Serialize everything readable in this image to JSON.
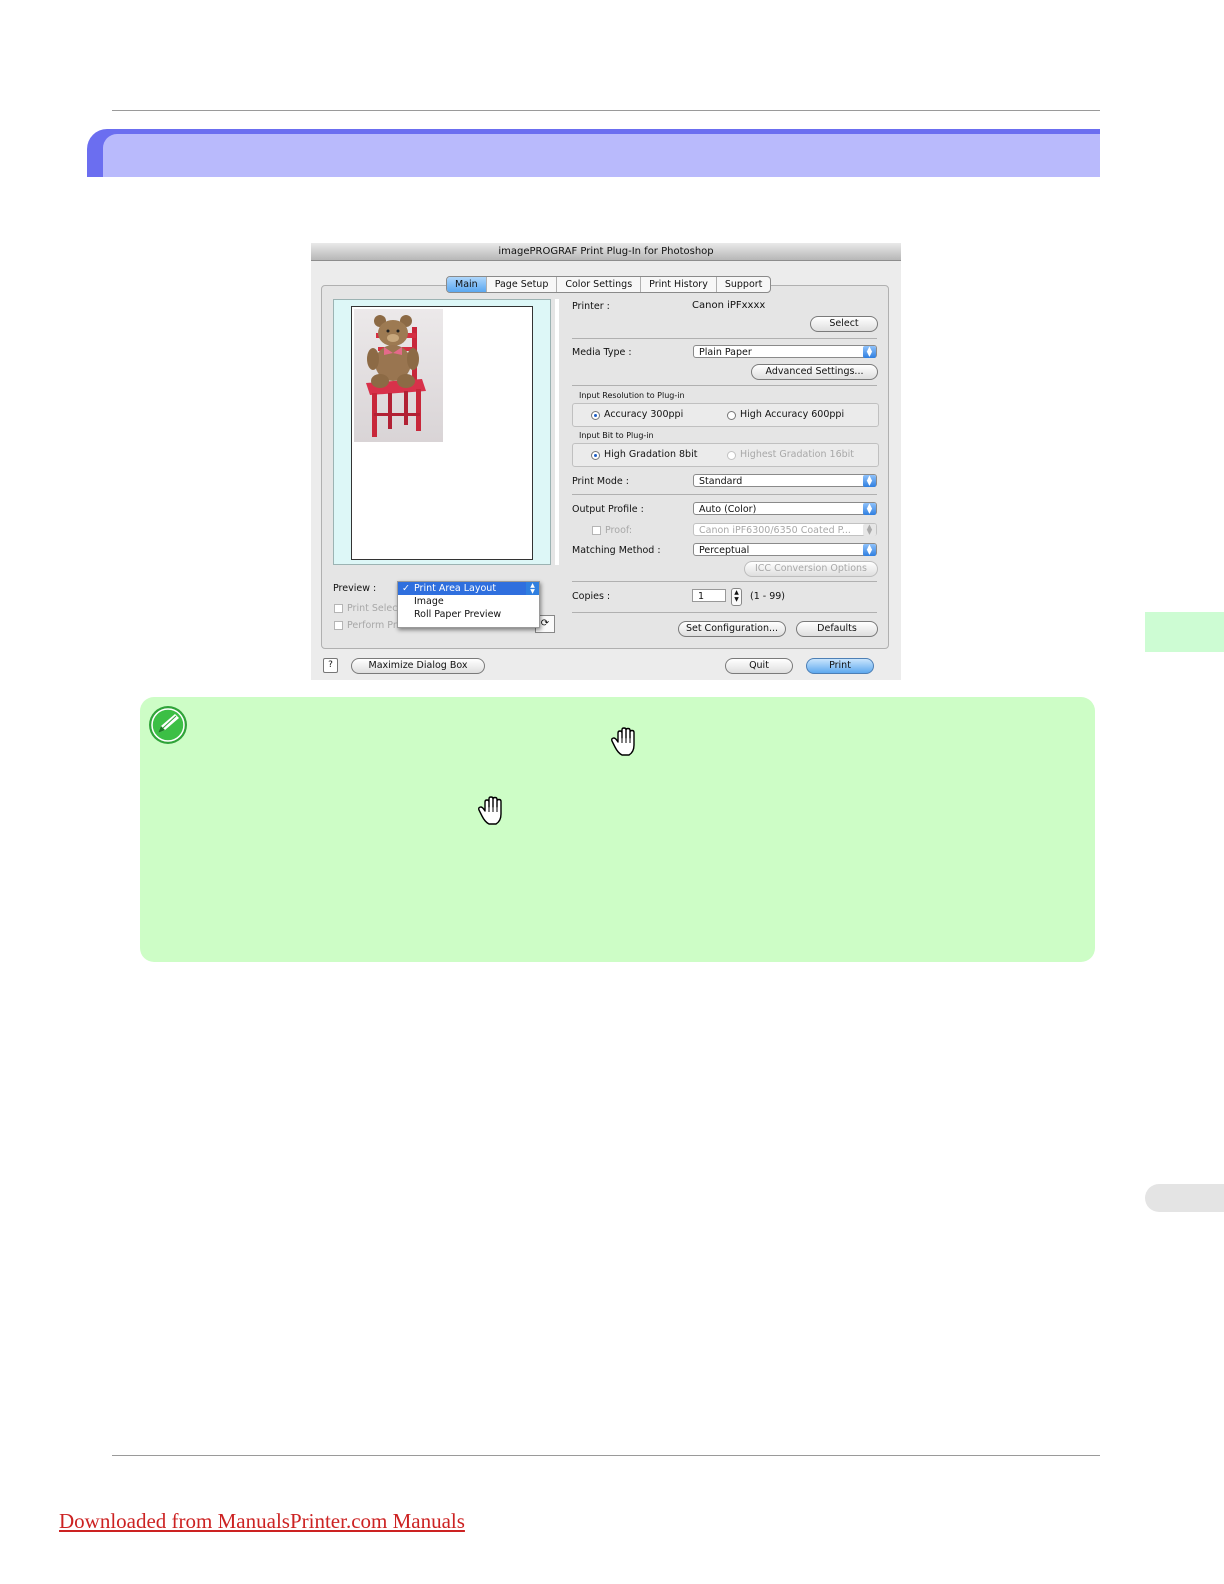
{
  "dialog": {
    "title": "imagePROGRAF Print Plug-In for Photoshop",
    "tabs": [
      {
        "label": "Main",
        "active": true
      },
      {
        "label": "Page Setup",
        "active": false
      },
      {
        "label": "Color Settings",
        "active": false
      },
      {
        "label": "Print History",
        "active": false
      },
      {
        "label": "Support",
        "active": false
      }
    ],
    "printer_label": "Printer :",
    "printer_value": "Canon iPFxxxx",
    "select_button": "Select",
    "media_type_label": "Media Type :",
    "media_type_value": "Plain Paper",
    "advanced_settings_button": "Advanced Settings...",
    "input_resolution_title": "Input Resolution to Plug-in",
    "input_resolution_options": [
      {
        "label": "Accuracy 300ppi",
        "selected": true,
        "enabled": true
      },
      {
        "label": "High Accuracy 600ppi",
        "selected": false,
        "enabled": true
      }
    ],
    "input_bit_title": "Input Bit to Plug-in",
    "input_bit_options": [
      {
        "label": "High Gradation 8bit",
        "selected": true,
        "enabled": true
      },
      {
        "label": "Highest Gradation 16bit",
        "selected": false,
        "enabled": false
      }
    ],
    "print_mode_label": "Print Mode :",
    "print_mode_value": "Standard",
    "output_profile_label": "Output Profile :",
    "output_profile_value": "Auto (Color)",
    "proof_label": "Proof:",
    "proof_value": "Canon iPF6300/6350 Coated P...",
    "matching_method_label": "Matching Method :",
    "matching_method_value": "Perceptual",
    "icc_button": "ICC Conversion Options",
    "copies_label": "Copies :",
    "copies_value": "1",
    "copies_range": "(1 - 99)",
    "set_configuration_button": "Set Configuration...",
    "defaults_button": "Defaults",
    "preview_label": "Preview :",
    "preview_menu": [
      {
        "label": "Print Area Layout",
        "checked": true
      },
      {
        "label": "Image",
        "checked": false
      },
      {
        "label": "Roll Paper Preview",
        "checked": false
      }
    ],
    "print_selected_label": "Print Select",
    "perform_proof_label": "Perform Proof in Preview",
    "help_icon_glyph": "?",
    "maximize_button": "Maximize Dialog Box",
    "quit_button": "Quit",
    "print_button": "Print"
  },
  "icons": {
    "note": "pencil-note-icon",
    "hand": "hand-cursor-icon"
  },
  "colors": {
    "header_band": "#b9bafc",
    "header_accent": "#6b6ef0",
    "note_bg": "#cdfdc6",
    "link": "#cc2222"
  },
  "footer": {
    "download_link": "Downloaded from ManualsPrinter.com Manuals"
  }
}
